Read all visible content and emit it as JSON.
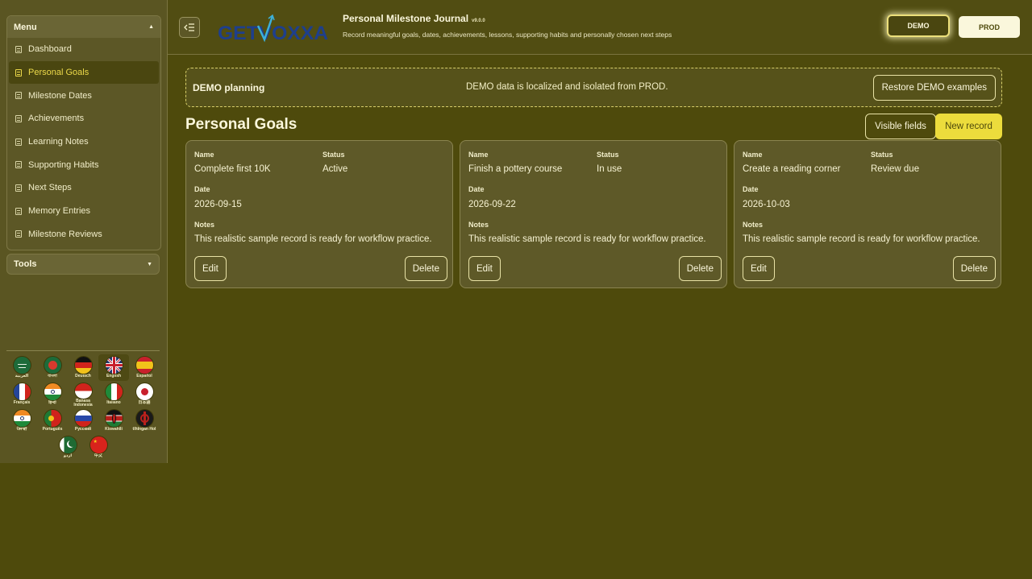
{
  "sidebar": {
    "menu_title": "Menu",
    "items": [
      {
        "label": "Dashboard"
      },
      {
        "label": "Personal Goals",
        "active": true
      },
      {
        "label": "Milestone Dates"
      },
      {
        "label": "Achievements"
      },
      {
        "label": "Learning Notes"
      },
      {
        "label": "Supporting Habits"
      },
      {
        "label": "Next Steps"
      },
      {
        "label": "Memory Entries"
      },
      {
        "label": "Milestone Reviews"
      }
    ],
    "tools_title": "Tools",
    "languages": [
      {
        "label": "العربية"
      },
      {
        "label": "বাংলা"
      },
      {
        "label": "Deutsch"
      },
      {
        "label": "English",
        "selected": true
      },
      {
        "label": "Español"
      },
      {
        "label": "Français"
      },
      {
        "label": "हिन्दी"
      },
      {
        "label": "Bahasa Indonesia"
      },
      {
        "label": "Italiano"
      },
      {
        "label": "日本語"
      },
      {
        "label": "ਪੰਜਾਬੀ"
      },
      {
        "label": "Português"
      },
      {
        "label": "Русский"
      },
      {
        "label": "Kiswahili"
      },
      {
        "label": "tlhIngan Hol"
      },
      {
        "label": "اردو"
      },
      {
        "label": "中文"
      }
    ]
  },
  "header": {
    "logo_text": "GETVOXXA",
    "app_title": "Personal Milestone Journal",
    "version": "v9.0.0",
    "subtitle": "Record meaningful goals, dates, achievements, lessons, supporting habits and personally chosen next steps",
    "env_demo": "DEMO",
    "env_prod": "PROD"
  },
  "banner": {
    "title": "DEMO planning",
    "message": "DEMO data is localized and isolated from PROD.",
    "restore_label": "Restore DEMO examples"
  },
  "main": {
    "page_title": "Personal Goals",
    "visible_fields_label": "Visible fields",
    "new_record_label": "New record",
    "field_labels": {
      "name": "Name",
      "status": "Status",
      "date": "Date",
      "notes": "Notes"
    },
    "edit_label": "Edit",
    "delete_label": "Delete",
    "records": [
      {
        "name": "Complete first 10K",
        "status": "Active",
        "date": "2026-09-15",
        "notes": "This realistic sample record is ready for workflow practice."
      },
      {
        "name": "Finish a pottery course",
        "status": "In use",
        "date": "2026-09-22",
        "notes": "This realistic sample record is ready for workflow practice."
      },
      {
        "name": "Create a reading corner",
        "status": "Review due",
        "date": "2026-10-03",
        "notes": "This realistic sample record is ready for workflow practice."
      }
    ]
  },
  "colors": {
    "background": "#4e4a0c",
    "accent": "#ecdc3c",
    "text": "#f3efc6"
  }
}
